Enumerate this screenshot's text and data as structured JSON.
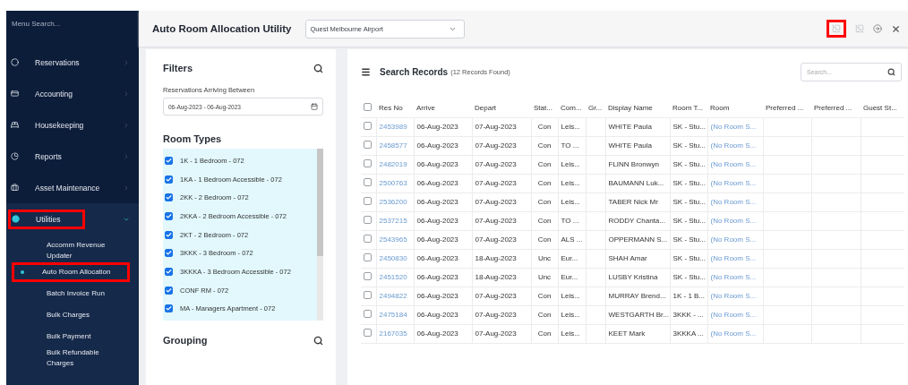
{
  "sidebar": {
    "search_placeholder": "Menu Search...",
    "items": [
      {
        "kind": "reservations",
        "label": "Reservations",
        "expanded": false,
        "highlighted": false
      },
      {
        "kind": "accounting",
        "label": "Accounting",
        "expanded": false,
        "highlighted": false
      },
      {
        "kind": "housekeeping",
        "label": "Housekeeping",
        "expanded": false,
        "highlighted": false
      },
      {
        "kind": "reports",
        "label": "Reports",
        "expanded": false,
        "highlighted": false
      },
      {
        "kind": "assets",
        "label": "Asset Maintenance",
        "expanded": false,
        "highlighted": false
      },
      {
        "kind": "utilities",
        "label": "Utilities",
        "expanded": true,
        "highlighted": true,
        "children": [
          {
            "label": "Accomm Revenue Updater",
            "selected": false,
            "highlighted": false
          },
          {
            "label": "Auto Room Allocation",
            "selected": true,
            "highlighted": true
          },
          {
            "label": "Batch Invoice Run",
            "selected": false,
            "highlighted": false
          },
          {
            "label": "Bulk Charges",
            "selected": false,
            "highlighted": false
          },
          {
            "label": "Bulk Payment",
            "selected": false,
            "highlighted": false
          },
          {
            "label": "Bulk Refundable Charges",
            "selected": false,
            "highlighted": false
          }
        ]
      }
    ]
  },
  "header": {
    "title": "Auto Room Allocation Utility",
    "property": "Quest Melbourne Airport",
    "toolbar": [
      {
        "kind": "crossed-image",
        "highlighted": true,
        "disabled": true
      },
      {
        "kind": "crossed-image",
        "highlighted": false,
        "disabled": true
      },
      {
        "kind": "arrow-circle",
        "highlighted": false,
        "disabled": false
      },
      {
        "kind": "close",
        "highlighted": false,
        "disabled": false
      }
    ]
  },
  "filters": {
    "title": "Filters",
    "date_label": "Reservations Arriving Between",
    "date_range": "06-Aug-2023 - 06-Aug-2023",
    "room_types_title": "Room Types",
    "room_types": [
      {
        "label": "1K - 1 Bedroom - 072",
        "checked": true
      },
      {
        "label": "1KA - 1 Bedroom Accessible - 072",
        "checked": true
      },
      {
        "label": "2KK - 2 Bedroom - 072",
        "checked": true
      },
      {
        "label": "2KKA - 2 Bedroom Accessible - 072",
        "checked": true
      },
      {
        "label": "2KT - 2 Bedroom - 072",
        "checked": true
      },
      {
        "label": "3KKK - 3 Bedroom - 072",
        "checked": true
      },
      {
        "label": "3KKKA - 3 Bedroom Accessible - 072",
        "checked": true
      },
      {
        "label": "CONF RM - 072",
        "checked": true
      },
      {
        "label": "MA - Managers Apartment - 072",
        "checked": true
      }
    ],
    "grouping_title": "Grouping"
  },
  "records": {
    "title": "Search Records",
    "count": "(12 Records Found)",
    "search_placeholder": "Search...",
    "select_all_checked": false,
    "columns": [
      "Res No",
      "Arrive",
      "Depart",
      "Stat...",
      "Com...",
      "Gr...",
      "Display Name",
      "Room T...",
      "Room",
      "Preferred ...",
      "Preferred ...",
      "Guest St..."
    ],
    "rows": [
      {
        "checked": false,
        "cells": [
          "2453989",
          "06-Aug-2023",
          "07-Aug-2023",
          "Con",
          "Leis...",
          "",
          "WHITE Paula",
          "SK - Stu...",
          "(No Room S...",
          "",
          "",
          ""
        ]
      },
      {
        "checked": false,
        "cells": [
          "2458577",
          "06-Aug-2023",
          "07-Aug-2023",
          "Con",
          "TO ...",
          "",
          "WHITE Paula",
          "SK - Stu...",
          "(No Room S...",
          "",
          "",
          ""
        ]
      },
      {
        "checked": false,
        "cells": [
          "2482019",
          "06-Aug-2023",
          "07-Aug-2023",
          "Con",
          "Leis...",
          "",
          "FLINN Bronwyn",
          "SK - Stu...",
          "(No Room S...",
          "",
          "",
          ""
        ]
      },
      {
        "checked": false,
        "cells": [
          "2500763",
          "06-Aug-2023",
          "07-Aug-2023",
          "Con",
          "Leis...",
          "",
          "BAUMANN Luk...",
          "SK - Stu...",
          "(No Room S...",
          "",
          "",
          ""
        ]
      },
      {
        "checked": false,
        "cells": [
          "2536200",
          "06-Aug-2023",
          "07-Aug-2023",
          "Con",
          "Leis...",
          "",
          "TABER Nick Mr",
          "SK - Stu...",
          "(No Room S...",
          "",
          "",
          ""
        ]
      },
      {
        "checked": false,
        "cells": [
          "2537215",
          "06-Aug-2023",
          "07-Aug-2023",
          "Con",
          "TO ...",
          "",
          "RODDY Chanta...",
          "SK - Stu...",
          "(No Room S...",
          "",
          "",
          ""
        ]
      },
      {
        "checked": false,
        "cells": [
          "2543965",
          "06-Aug-2023",
          "07-Aug-2023",
          "Con",
          "ALS ...",
          "",
          "OPPERMANN S...",
          "SK - Stu...",
          "(No Room S...",
          "",
          "",
          ""
        ]
      },
      {
        "checked": false,
        "cells": [
          "2450830",
          "06-Aug-2023",
          "18-Aug-2023",
          "Unc",
          "Eur...",
          "",
          "SHAH Amar",
          "SK - Stu...",
          "(No Room S...",
          "",
          "",
          ""
        ]
      },
      {
        "checked": false,
        "cells": [
          "2451520",
          "06-Aug-2023",
          "18-Aug-2023",
          "Unc",
          "Eur...",
          "",
          "LUSBY Kristina",
          "SK - Stu...",
          "(No Room S...",
          "",
          "",
          ""
        ]
      },
      {
        "checked": false,
        "cells": [
          "2494822",
          "06-Aug-2023",
          "07-Aug-2023",
          "Con",
          "Leis...",
          "",
          "MURRAY Brend...",
          "1K - 1 B...",
          "(No Room S...",
          "",
          "",
          ""
        ]
      },
      {
        "checked": false,
        "cells": [
          "2475184",
          "06-Aug-2023",
          "07-Aug-2023",
          "Con",
          "Leis...",
          "",
          "WESTGARTH Br...",
          "3KKK - ...",
          "(No Room S...",
          "",
          "",
          ""
        ]
      },
      {
        "checked": false,
        "cells": [
          "2167035",
          "06-Aug-2023",
          "07-Aug-2023",
          "Con",
          "Leis...",
          "",
          "KEET Mark",
          "3KKKA ...",
          "(No Room S...",
          "",
          "",
          ""
        ]
      }
    ]
  }
}
